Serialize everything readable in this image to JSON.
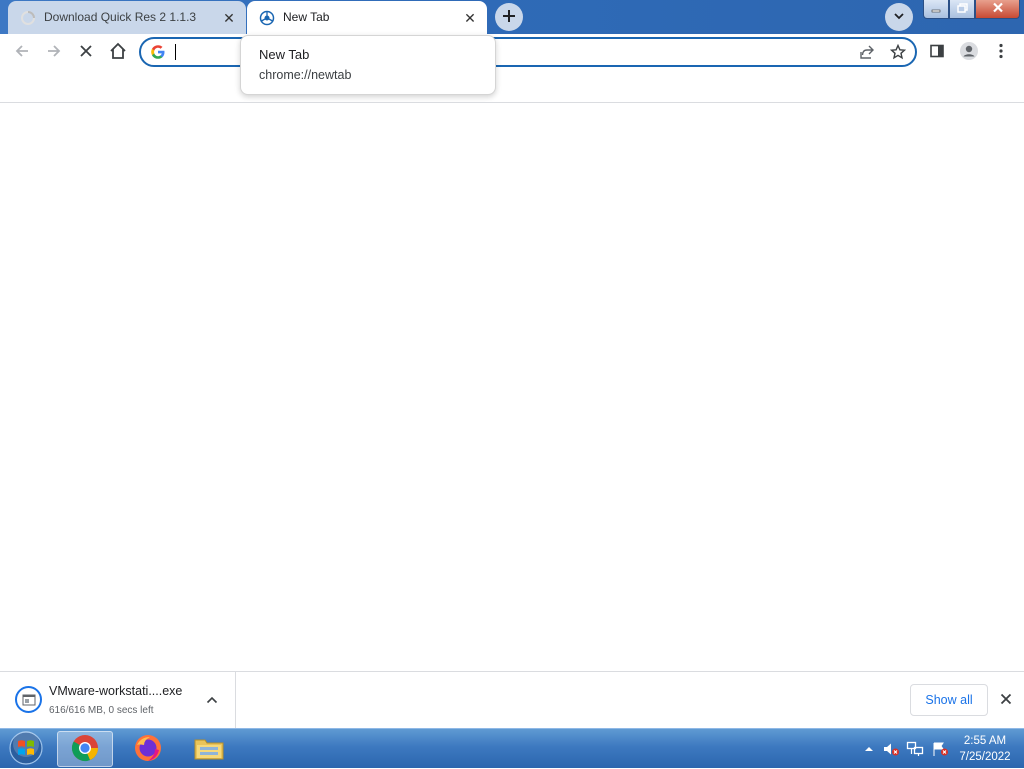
{
  "browser": {
    "tabs": [
      {
        "title": "Download Quick Res 2 1.1.3",
        "active": false,
        "favicon": "loading-spinner-icon"
      },
      {
        "title": "New Tab",
        "active": true,
        "favicon": "chrome-newtab-icon"
      }
    ],
    "new_tab_icon": "plus-icon",
    "tab_search_icon": "chevron-down-icon",
    "window_controls": [
      "minimize-icon",
      "restore-icon",
      "close-icon"
    ]
  },
  "toolbar": {
    "back_icon": "arrow-left-icon",
    "forward_icon": "arrow-right-icon",
    "stop_icon": "close-icon",
    "home_icon": "home-icon",
    "omnibox": {
      "value": "",
      "placeholder": "",
      "search_engine_icon": "google-g-icon"
    },
    "share_icon": "share-icon",
    "bookmark_icon": "star-icon",
    "side_panel_icon": "side-panel-icon",
    "profile_icon": "profile-icon",
    "menu_icon": "more-vertical-icon"
  },
  "hover_card": {
    "title": "New Tab",
    "url": "chrome://newtab"
  },
  "download_shelf": {
    "item": {
      "filename": "VMware-workstati....exe",
      "status": "616/616 MB, 0 secs left"
    },
    "show_all_label": "Show all"
  },
  "taskbar": {
    "apps": [
      "chrome-icon",
      "firefox-icon",
      "file-explorer-icon"
    ],
    "clock": {
      "time": "2:55 AM",
      "date": "7/25/2022"
    }
  },
  "colors": {
    "titlebar": "#2f6bb8",
    "accent": "#1a73e8",
    "omnibox_border": "#1a66b2"
  }
}
